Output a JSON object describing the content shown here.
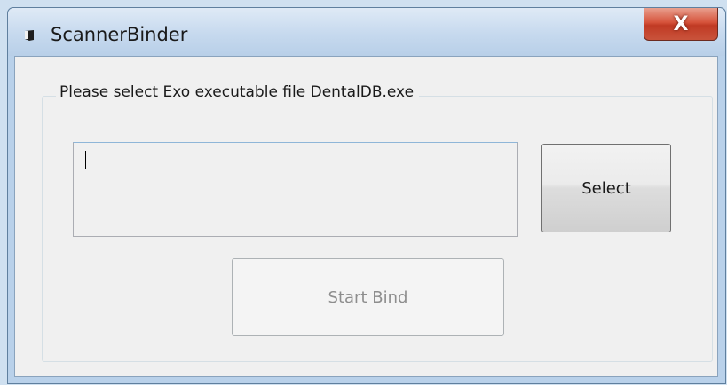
{
  "window": {
    "title": "ScannerBinder",
    "close_label": "X"
  },
  "group": {
    "label": "Please select Exo executable file DentalDB.exe"
  },
  "path_input": {
    "value": ""
  },
  "buttons": {
    "select_label": "Select",
    "start_bind_label": "Start Bind",
    "start_bind_enabled": false
  },
  "icons": {
    "app": "app-icon",
    "close": "close-icon"
  }
}
